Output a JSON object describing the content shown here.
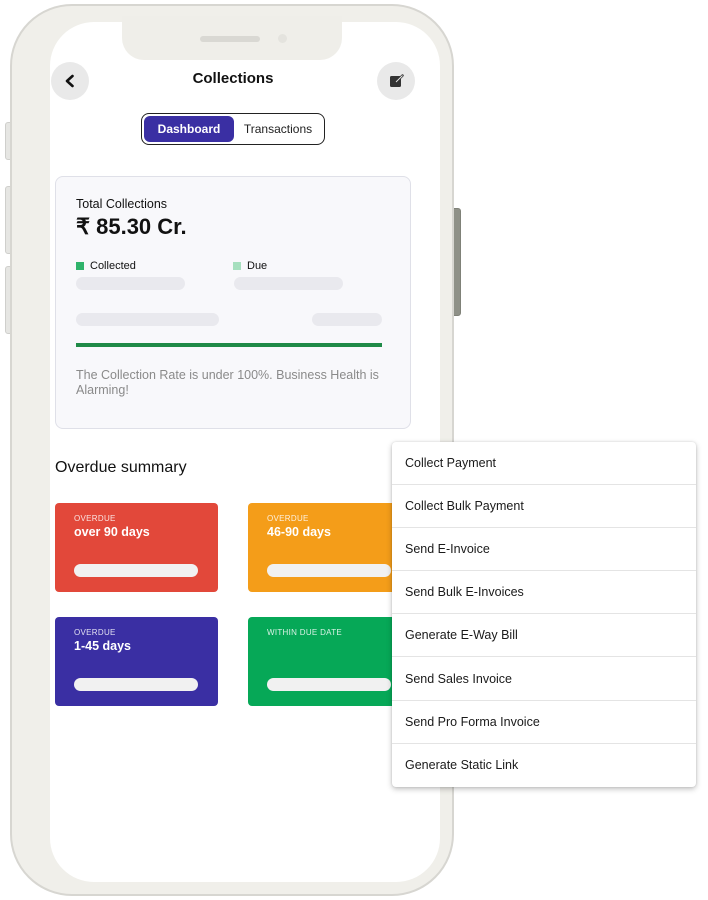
{
  "header": {
    "title": "Collections",
    "back_icon": "chevron-left-icon",
    "edit_icon": "edit-icon"
  },
  "tabs": [
    {
      "label": "Dashboard",
      "active": true
    },
    {
      "label": "Transactions",
      "active": false
    }
  ],
  "summary": {
    "label": "Total Collections",
    "amount": "₹ 85.30 Cr.",
    "legend": [
      {
        "label": "Collected",
        "color": "#2fb36b"
      },
      {
        "label": "Due",
        "color": "#a6dfbe"
      }
    ],
    "note": "The Collection Rate is under 100%. Business Health is Alarming!"
  },
  "overdue": {
    "title": "Overdue summary",
    "tiles": [
      {
        "kicker": "OVERDUE",
        "label": "over 90 days",
        "color": "#e2483a"
      },
      {
        "kicker": "OVERDUE",
        "label": "46-90 days",
        "color": "#f49d19"
      },
      {
        "kicker": "OVERDUE",
        "label": "1-45 days",
        "color": "#3a2fa3"
      },
      {
        "kicker": "WITHIN DUE DATE",
        "label": "",
        "color": "#06a857"
      }
    ]
  },
  "menu": {
    "items": [
      {
        "label": "Collect Payment"
      },
      {
        "label": "Collect Bulk Payment"
      },
      {
        "label": "Send E-Invoice"
      },
      {
        "label": "Send Bulk E-Invoices"
      },
      {
        "label": "Generate E-Way Bill"
      },
      {
        "label": "Send Sales Invoice"
      },
      {
        "label": "Send Pro Forma Invoice"
      },
      {
        "label": "Generate Static Link"
      }
    ]
  },
  "colors": {
    "accent": "#3a2fa3",
    "progress_bar": "#1f8a47"
  }
}
